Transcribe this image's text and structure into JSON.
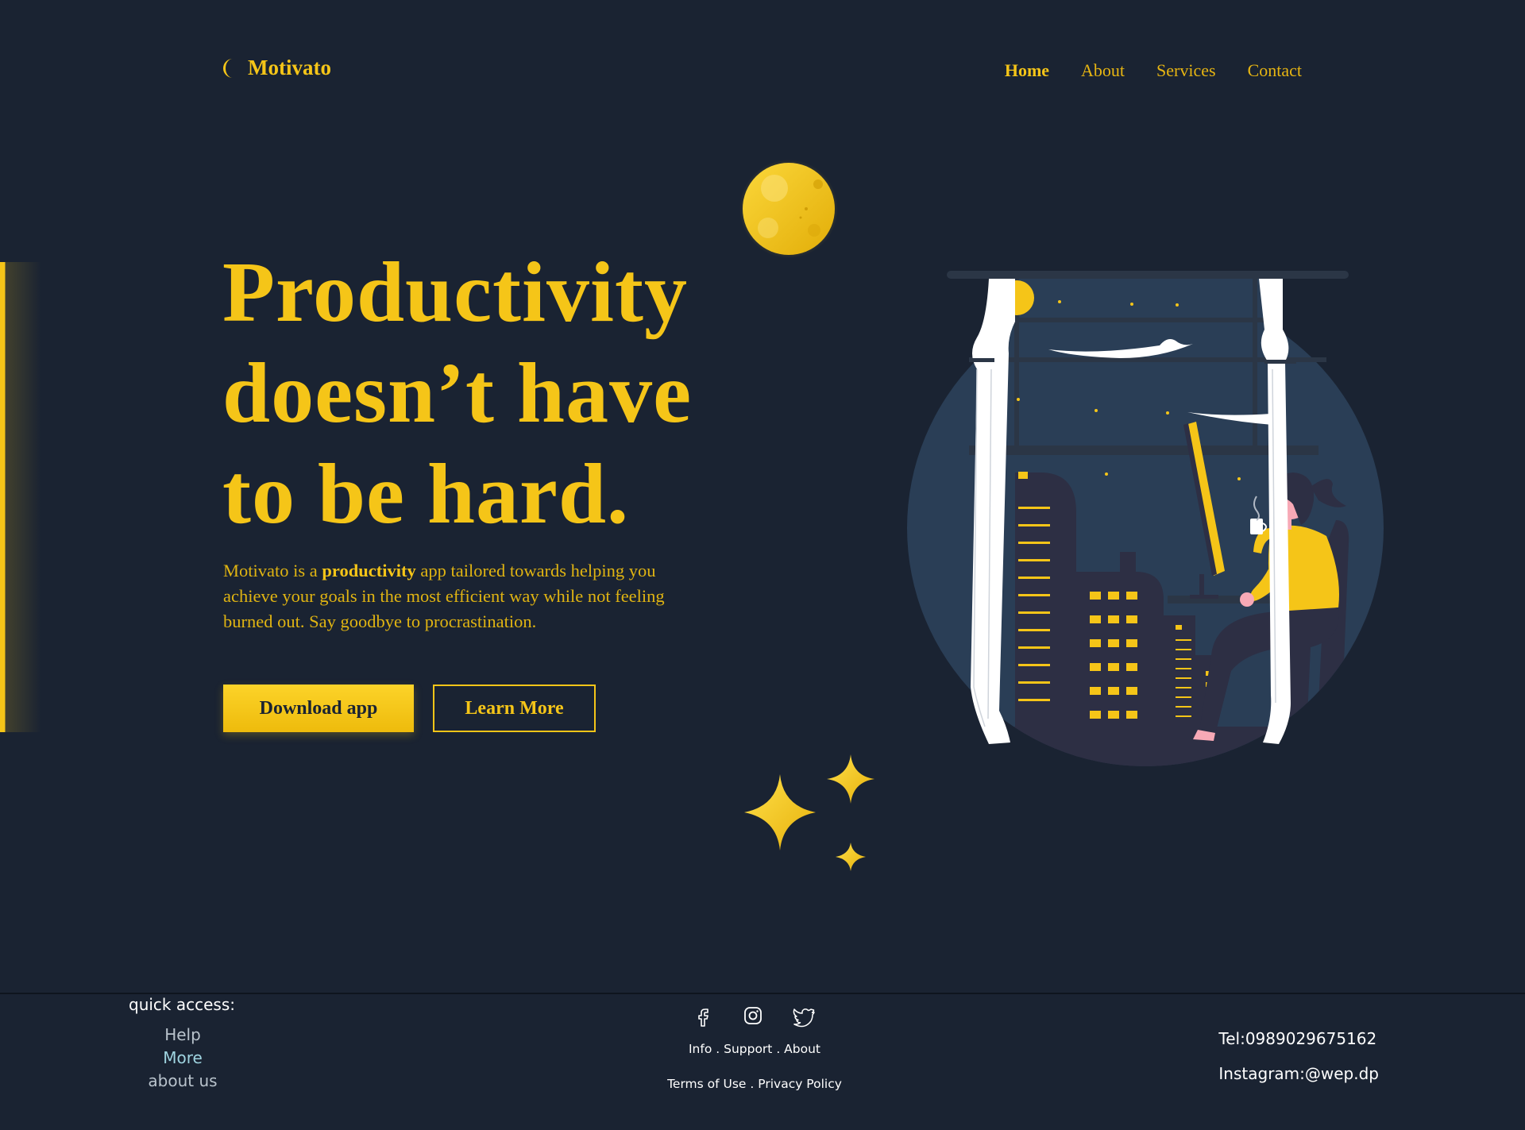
{
  "brand": {
    "name": "Motivato",
    "accent_color": "#f5c518",
    "background_color": "#1a2332"
  },
  "nav": {
    "items": [
      {
        "label": "Home",
        "active": true
      },
      {
        "label": "About"
      },
      {
        "label": "Services"
      },
      {
        "label": "Contact"
      }
    ]
  },
  "hero": {
    "title_lines": [
      "Productivity",
      "doesn’t have",
      "to be hard."
    ],
    "desc_pre": "Motivato is a ",
    "desc_bold": "productivity",
    "desc_post": " app tailored towards helping you achieve your goals in the most efficient way while not feeling burned out. Say goodbye to procrastination.",
    "primary_button": "Download app",
    "secondary_button": "Learn More"
  },
  "decor": {
    "moon_icon": "moon-icon",
    "stars_icon": "sparkle-stars-icon",
    "illustration": "woman-at-window-city-night-illustration"
  },
  "footer": {
    "quick_access_title": "quick access:",
    "quick_links": [
      "Help",
      "More",
      "about us"
    ],
    "social_icons": [
      "facebook-icon",
      "instagram-icon",
      "twitter-icon"
    ],
    "links_row1": [
      "Info",
      "Support",
      "About"
    ],
    "links_row2": [
      "Terms of Use",
      "Privacy Policy"
    ],
    "tel": "Tel:0989029675162",
    "instagram": "Instagram:@wep.dp"
  }
}
